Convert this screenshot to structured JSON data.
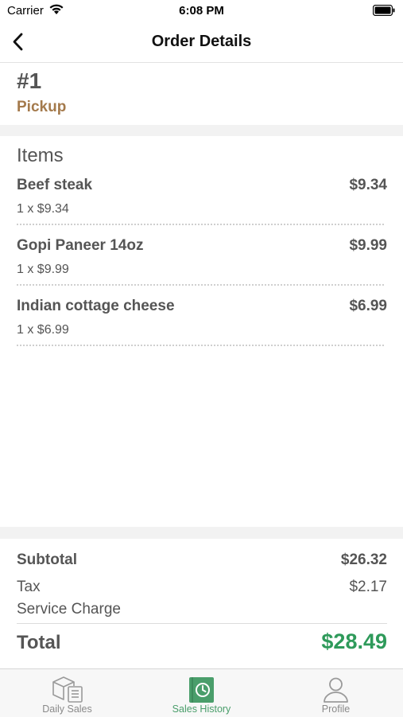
{
  "status_bar": {
    "carrier": "Carrier",
    "time": "6:08 PM"
  },
  "nav": {
    "title": "Order Details",
    "back_icon": "chevron-left-icon"
  },
  "order": {
    "number": "#1",
    "type": "Pickup"
  },
  "items_section": {
    "title": "Items",
    "items": [
      {
        "name": "Beef steak",
        "price": "$9.34",
        "qty_line": "1 x $9.34"
      },
      {
        "name": "Gopi Paneer 14oz",
        "price": "$9.99",
        "qty_line": "1 x $9.99"
      },
      {
        "name": "Indian cottage cheese",
        "price": "$6.99",
        "qty_line": "1 x $6.99"
      }
    ]
  },
  "summary": {
    "subtotal_label": "Subtotal",
    "subtotal_value": "$26.32",
    "tax_label": "Tax",
    "tax_value": "$2.17",
    "service_label": "Service Charge",
    "service_value": "",
    "total_label": "Total",
    "total_value": "$28.49"
  },
  "tab_bar": {
    "tabs": [
      {
        "label": "Daily Sales",
        "icon": "box-receipt-icon",
        "active": false
      },
      {
        "label": "Sales History",
        "icon": "history-book-icon",
        "active": true
      },
      {
        "label": "Profile",
        "icon": "person-icon",
        "active": false
      }
    ]
  },
  "colors": {
    "accent_green": "#2e9a5a",
    "tab_active": "#4a9e6b",
    "pickup_brown": "#a47a4c",
    "tab_inactive": "#8a8a8a"
  }
}
